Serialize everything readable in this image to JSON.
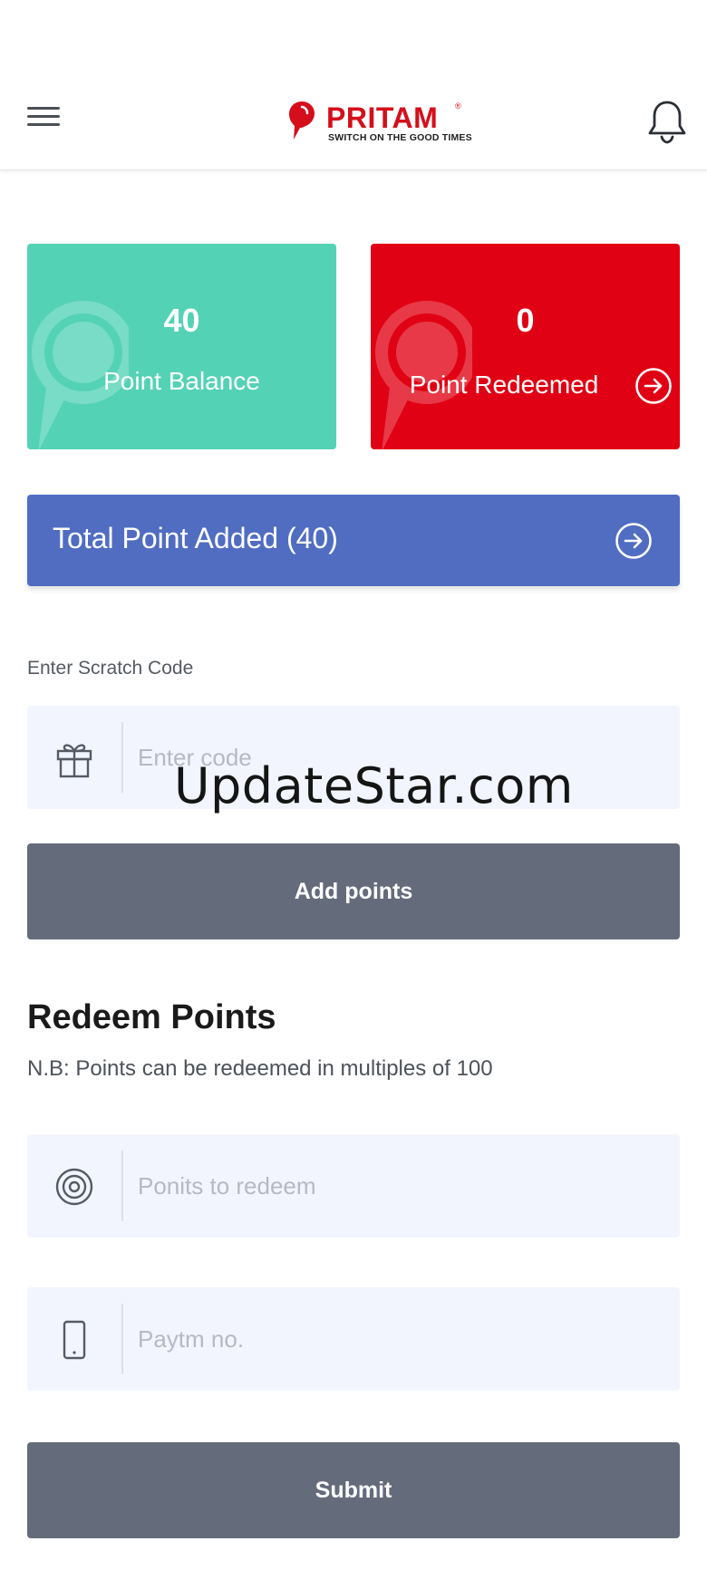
{
  "header": {
    "brand_name": "PRITAM",
    "brand_registered": "®",
    "brand_tagline": "SWITCH ON THE GOOD TIMES",
    "brand_color": "#d40f1b",
    "menu_icon": "hamburger-menu-icon",
    "notification_icon": "bell-icon"
  },
  "cards": {
    "balance": {
      "value": "40",
      "label": "Point Balance",
      "color": "#54d2b6"
    },
    "redeemed": {
      "value": "0",
      "label": "Point Redeemed",
      "color": "#e00214",
      "icon": "arrow-right-circle-icon"
    }
  },
  "total_points": {
    "label": "Total Point Added (40)",
    "color": "#506dc2",
    "icon": "arrow-right-circle-icon"
  },
  "scratch": {
    "label": "Enter Scratch Code",
    "placeholder": "Enter code",
    "icon": "gift-icon",
    "button_label": "Add points"
  },
  "redeem": {
    "title": "Redeem Points",
    "note": "N.B: Points can be redeemed in multiples of 100",
    "points_placeholder": "Ponits to redeem",
    "points_icon": "target-icon",
    "phone_placeholder": "Paytm no.",
    "phone_icon": "mobile-phone-icon",
    "submit_label": "Submit"
  },
  "overlay": {
    "watermark": "UpdateStar.com"
  },
  "button_color": "#646b7b",
  "input_background": "#f2f5fd"
}
